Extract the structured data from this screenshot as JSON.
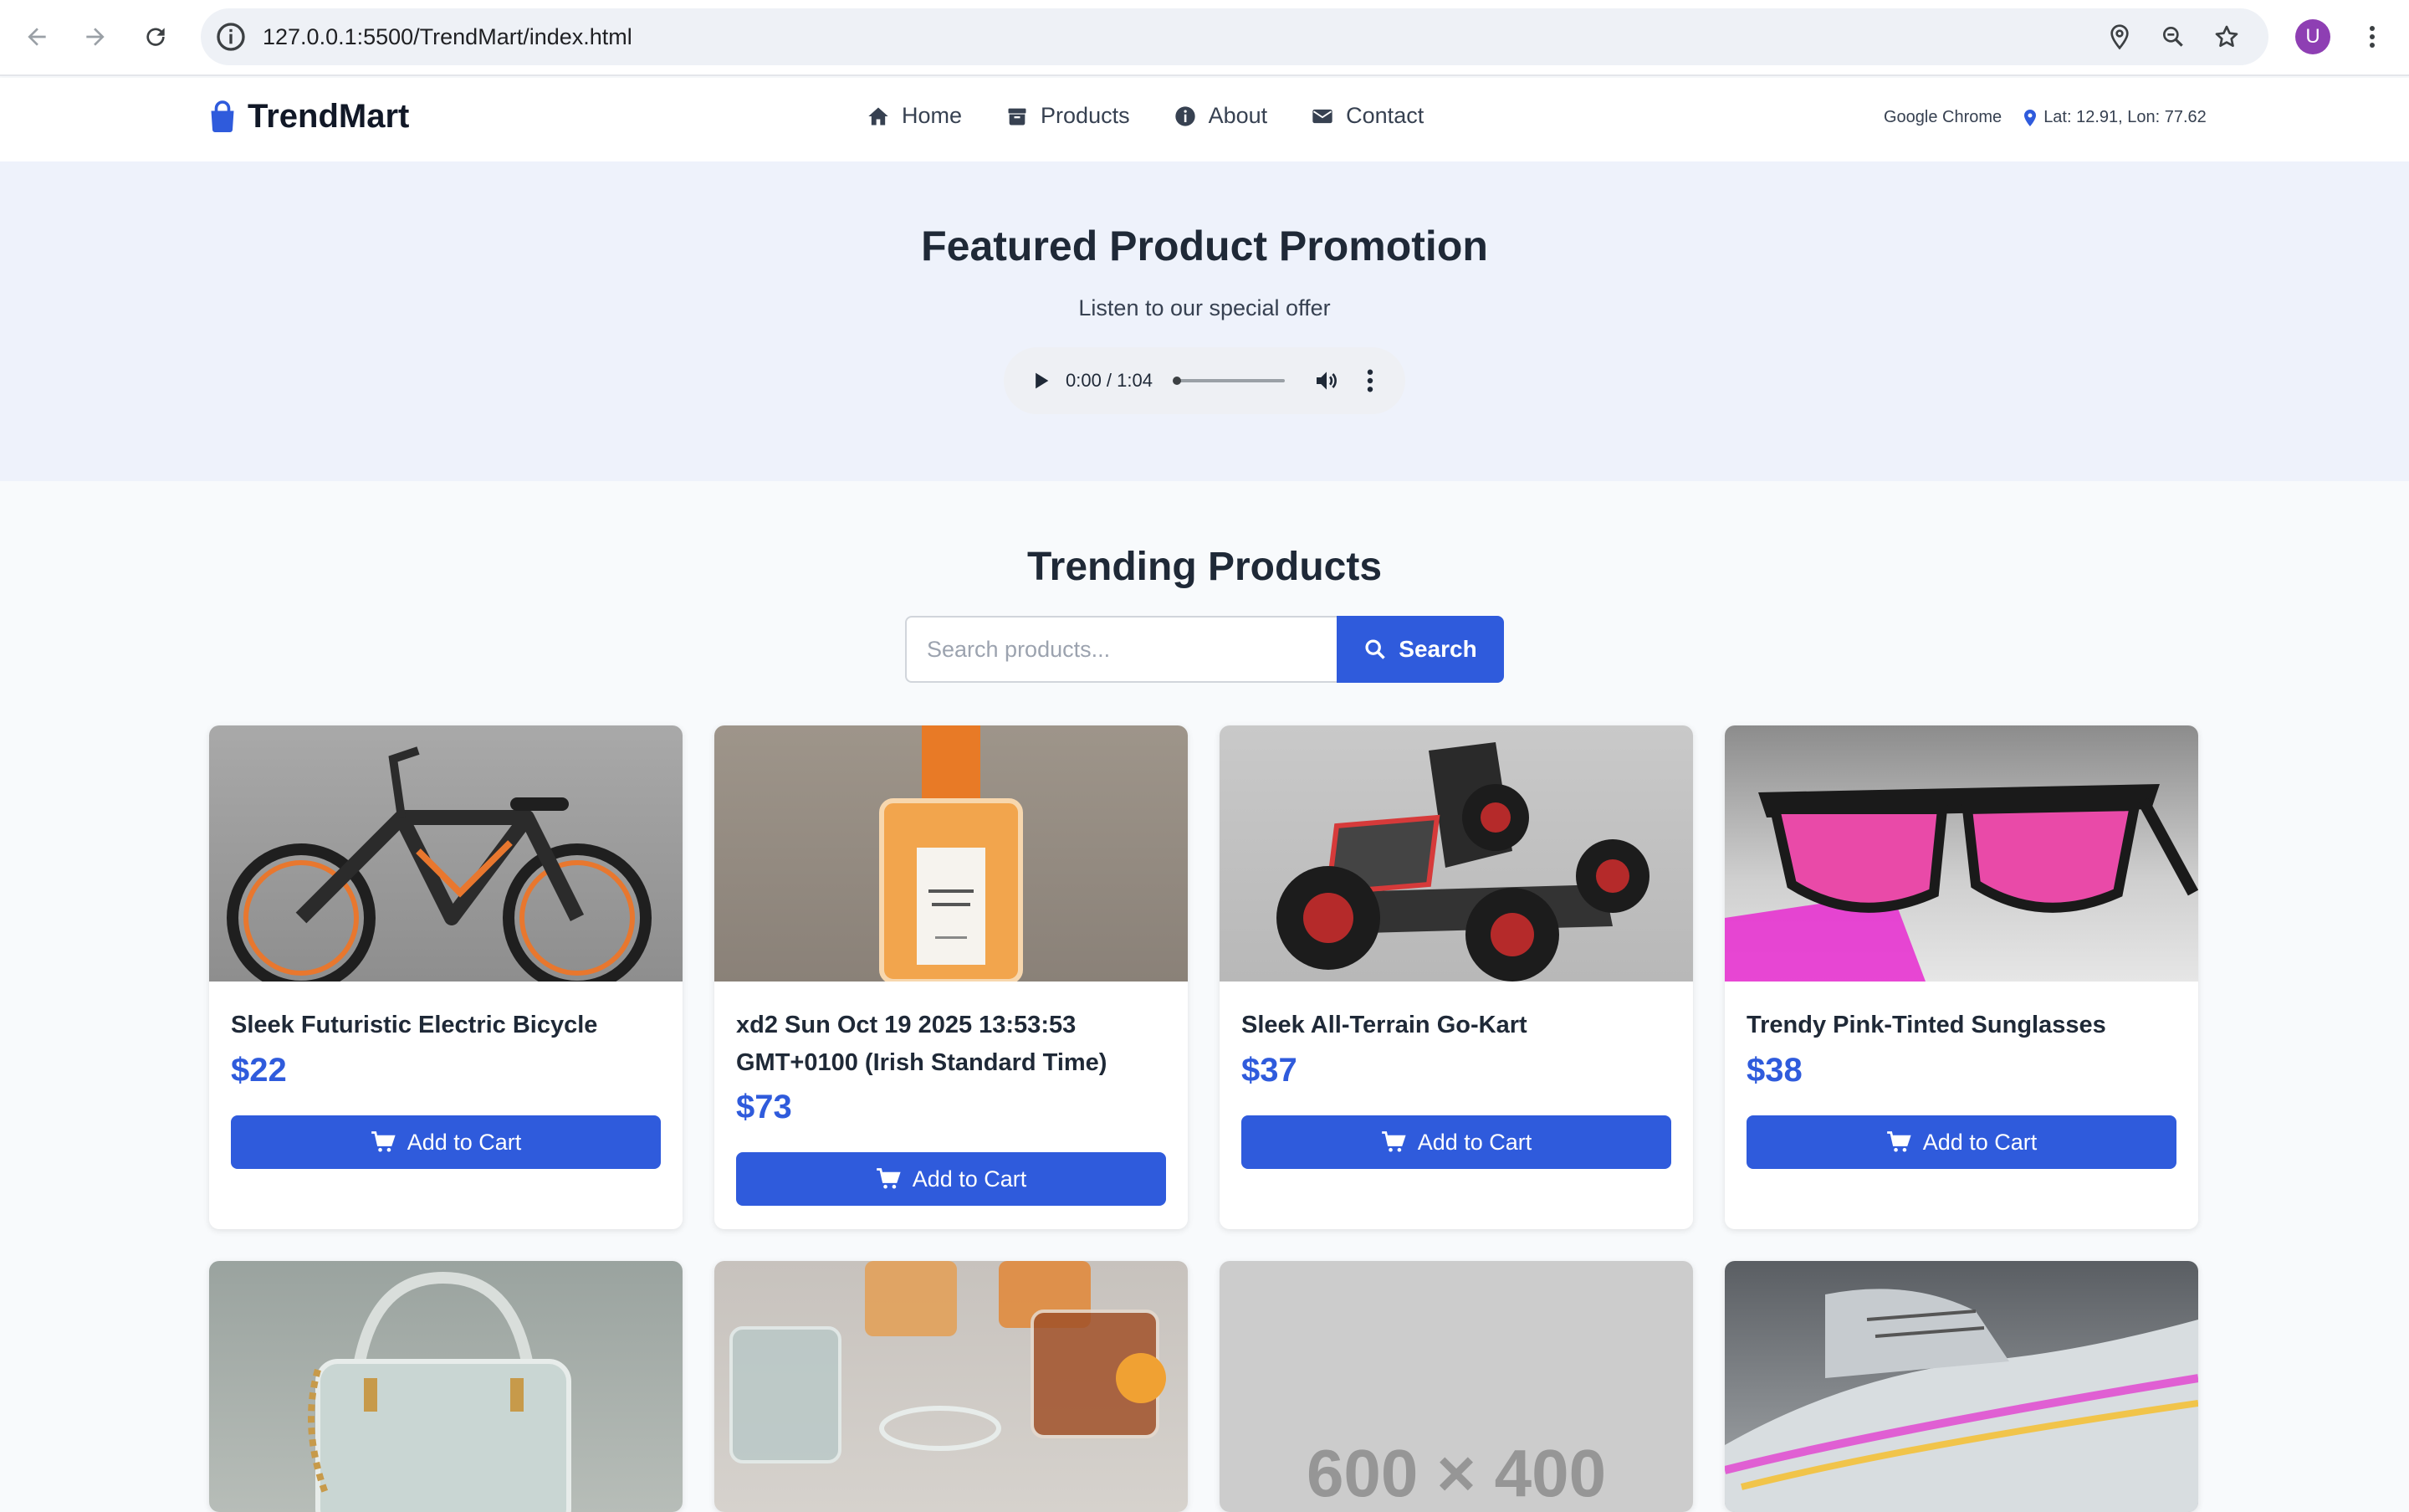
{
  "browser": {
    "url": "127.0.0.1:5500/TrendMart/index.html",
    "profile_initial": "U"
  },
  "header": {
    "logo_text": "TrendMart",
    "nav": [
      {
        "label": "Home",
        "icon": "home-icon"
      },
      {
        "label": "Products",
        "icon": "box-icon"
      },
      {
        "label": "About",
        "icon": "info-icon"
      },
      {
        "label": "Contact",
        "icon": "envelope-icon"
      }
    ],
    "browser_name": "Google Chrome",
    "location": "Lat: 12.91, Lon: 77.62"
  },
  "hero": {
    "title": "Featured Product Promotion",
    "subtitle": "Listen to our special offer",
    "audio_time": "0:00 / 1:04"
  },
  "products_section": {
    "title": "Trending Products",
    "search_placeholder": "Search products...",
    "search_button": "Search"
  },
  "products": [
    {
      "name": "Sleek Futuristic Electric Bicycle",
      "price": "$22",
      "button": "Add to Cart"
    },
    {
      "name": "xd2 Sun Oct 19 2025 13:53:53 GMT+0100 (Irish Standard Time)",
      "price": "$73",
      "button": "Add to Cart"
    },
    {
      "name": "Sleek All-Terrain Go-Kart",
      "price": "$37",
      "button": "Add to Cart"
    },
    {
      "name": "Trendy Pink-Tinted Sunglasses",
      "price": "$38",
      "button": "Add to Cart"
    }
  ],
  "placeholder_label": "600 × 400",
  "colors": {
    "accent": "#2f5bdc",
    "hero_bg": "#eef2fb",
    "page_bg": "#f8fafc"
  }
}
